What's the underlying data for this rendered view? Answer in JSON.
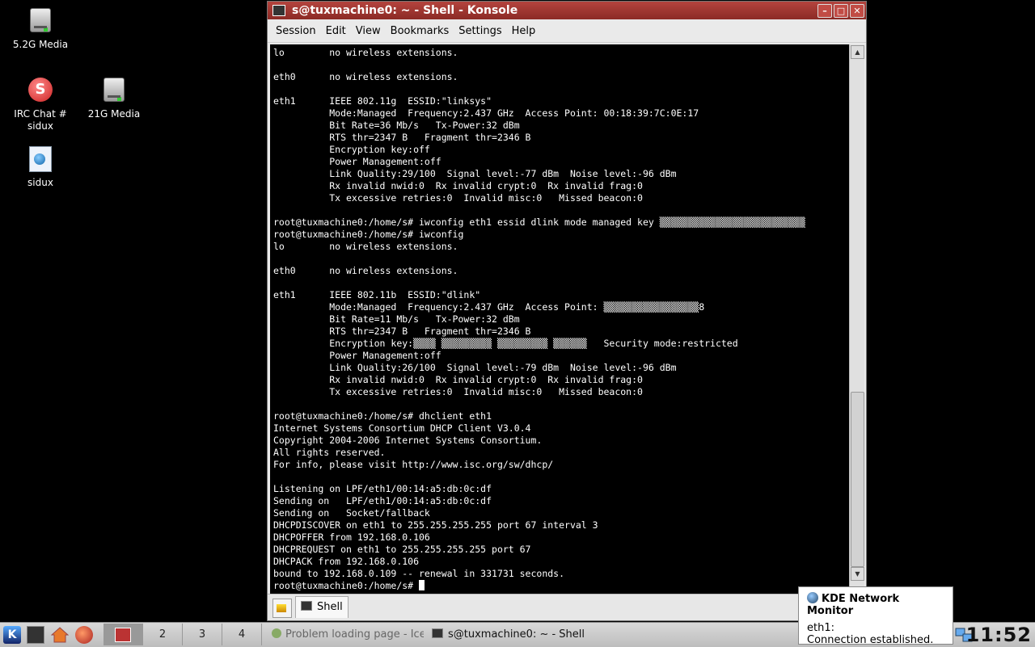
{
  "desktop": {
    "icons": [
      {
        "label": "5.2G Media"
      },
      {
        "label": "IRC Chat #\nsidux"
      },
      {
        "label": "21G Media"
      },
      {
        "label": "sidux"
      }
    ]
  },
  "window": {
    "title": "s@tuxmachine0: ~ - Shell - Konsole",
    "menu": [
      "Session",
      "Edit",
      "View",
      "Bookmarks",
      "Settings",
      "Help"
    ],
    "tab_label": "Shell",
    "terminal_lines": [
      "lo        no wireless extensions.",
      "",
      "eth0      no wireless extensions.",
      "",
      "eth1      IEEE 802.11g  ESSID:\"linksys\"",
      "          Mode:Managed  Frequency:2.437 GHz  Access Point: 00:18:39:7C:0E:17",
      "          Bit Rate=36 Mb/s   Tx-Power:32 dBm",
      "          RTS thr=2347 B   Fragment thr=2346 B",
      "          Encryption key:off",
      "          Power Management:off",
      "          Link Quality:29/100  Signal level:-77 dBm  Noise level:-96 dBm",
      "          Rx invalid nwid:0  Rx invalid crypt:0  Rx invalid frag:0",
      "          Tx excessive retries:0  Invalid misc:0   Missed beacon:0",
      "",
      "root@tuxmachine0:/home/s# iwconfig eth1 essid dlink mode managed key ▒▒▒▒▒▒▒▒▒▒▒▒▒▒▒▒▒▒▒▒▒▒▒▒▒▒",
      "root@tuxmachine0:/home/s# iwconfig",
      "lo        no wireless extensions.",
      "",
      "eth0      no wireless extensions.",
      "",
      "eth1      IEEE 802.11b  ESSID:\"dlink\"",
      "          Mode:Managed  Frequency:2.437 GHz  Access Point: ▒▒▒▒▒▒▒▒▒▒▒▒▒▒▒▒▒8",
      "          Bit Rate=11 Mb/s   Tx-Power:32 dBm",
      "          RTS thr=2347 B   Fragment thr=2346 B",
      "          Encryption key:▒▒▒▒ ▒▒▒▒▒▒▒▒▒ ▒▒▒▒▒▒▒▒▒ ▒▒▒▒▒▒   Security mode:restricted",
      "          Power Management:off",
      "          Link Quality:26/100  Signal level:-79 dBm  Noise level:-96 dBm",
      "          Rx invalid nwid:0  Rx invalid crypt:0  Rx invalid frag:0",
      "          Tx excessive retries:0  Invalid misc:0   Missed beacon:0",
      "",
      "root@tuxmachine0:/home/s# dhclient eth1",
      "Internet Systems Consortium DHCP Client V3.0.4",
      "Copyright 2004-2006 Internet Systems Consortium.",
      "All rights reserved.",
      "For info, please visit http://www.isc.org/sw/dhcp/",
      "",
      "Listening on LPF/eth1/00:14:a5:db:0c:df",
      "Sending on   LPF/eth1/00:14:a5:db:0c:df",
      "Sending on   Socket/fallback",
      "DHCPDISCOVER on eth1 to 255.255.255.255 port 67 interval 3",
      "DHCPOFFER from 192.168.0.106",
      "DHCPREQUEST on eth1 to 255.255.255.255 port 67",
      "DHCPACK from 192.168.0.106",
      "bound to 192.168.0.109 -- renewal in 331731 seconds."
    ],
    "prompt": "root@tuxmachine0:/home/s# "
  },
  "taskbar": {
    "pager": [
      "2",
      "3",
      "4"
    ],
    "tasks": [
      "Problem loading page - Ice",
      "s@tuxmachine0: ~ - Shell"
    ],
    "clock": "11:52"
  },
  "notification": {
    "title": "KDE Network Monitor",
    "line1": "eth1:",
    "line2": "Connection established."
  },
  "colors": {
    "titlebar": "#a33a34",
    "terminal_bg": "#000000",
    "terminal_fg": "#ffffff"
  }
}
